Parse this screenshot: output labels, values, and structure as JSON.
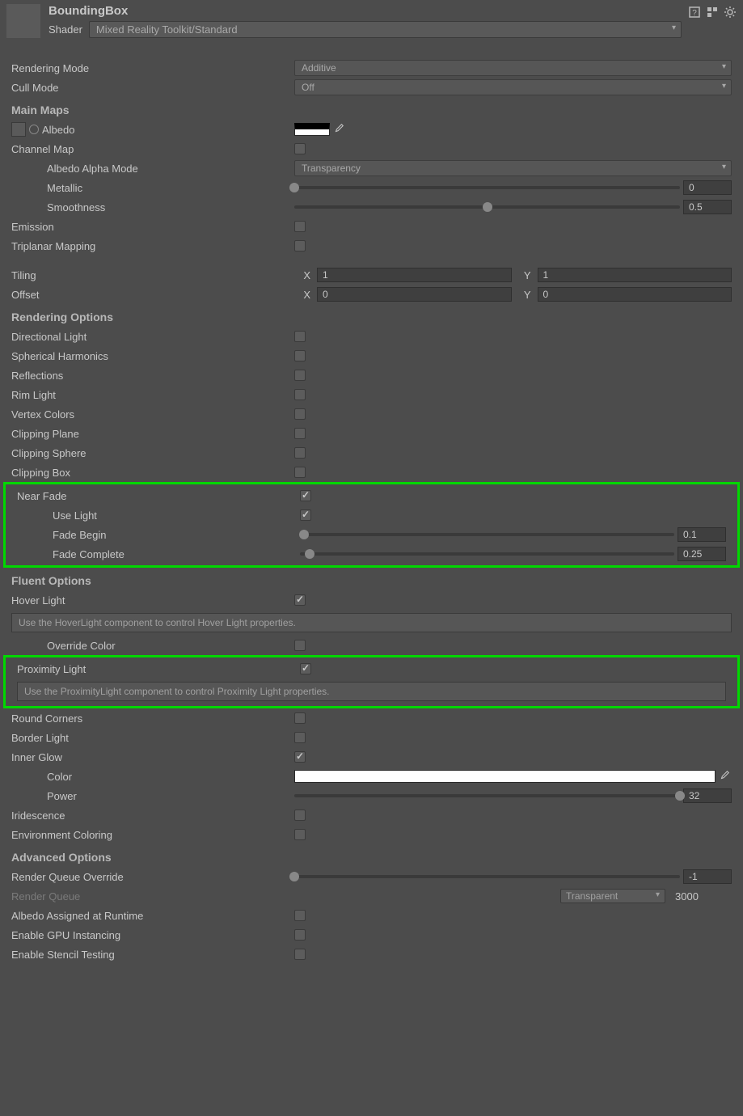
{
  "header": {
    "title": "BoundingBox",
    "shader_label": "Shader",
    "shader_value": "Mixed Reality Toolkit/Standard"
  },
  "rendering_mode": {
    "label": "Rendering Mode",
    "value": "Additive"
  },
  "cull_mode": {
    "label": "Cull Mode",
    "value": "Off"
  },
  "main_maps": {
    "heading": "Main Maps",
    "albedo_label": "Albedo",
    "channel_map_label": "Channel Map",
    "albedo_alpha_mode": {
      "label": "Albedo Alpha Mode",
      "value": "Transparency"
    },
    "metallic": {
      "label": "Metallic",
      "value": "0"
    },
    "smoothness": {
      "label": "Smoothness",
      "value": "0.5"
    },
    "emission_label": "Emission",
    "triplanar_label": "Triplanar Mapping",
    "tiling": {
      "label": "Tiling",
      "x": "1",
      "y": "1"
    },
    "offset": {
      "label": "Offset",
      "x": "0",
      "y": "0"
    },
    "x": "X",
    "y": "Y"
  },
  "rendering_options": {
    "heading": "Rendering Options",
    "directional_light": "Directional Light",
    "spherical_harmonics": "Spherical Harmonics",
    "reflections": "Reflections",
    "rim_light": "Rim Light",
    "vertex_colors": "Vertex Colors",
    "clipping_plane": "Clipping Plane",
    "clipping_sphere": "Clipping Sphere",
    "clipping_box": "Clipping Box",
    "near_fade": "Near Fade",
    "use_light": "Use Light",
    "fade_begin": {
      "label": "Fade Begin",
      "value": "0.1"
    },
    "fade_complete": {
      "label": "Fade Complete",
      "value": "0.25"
    }
  },
  "fluent_options": {
    "heading": "Fluent Options",
    "hover_light": "Hover Light",
    "hover_help": "Use the HoverLight component to control Hover Light properties.",
    "override_color": "Override Color",
    "proximity_light": "Proximity Light",
    "proximity_help": "Use the ProximityLight component to control Proximity Light properties.",
    "round_corners": "Round Corners",
    "border_light": "Border Light",
    "inner_glow": "Inner Glow",
    "color_label": "Color",
    "power": {
      "label": "Power",
      "value": "32"
    },
    "iridescence": "Iridescence",
    "environment_coloring": "Environment Coloring"
  },
  "advanced_options": {
    "heading": "Advanced Options",
    "render_queue_override": {
      "label": "Render Queue Override",
      "value": "-1"
    },
    "render_queue": {
      "label": "Render Queue",
      "dropdown": "Transparent",
      "value": "3000"
    },
    "albedo_runtime": "Albedo Assigned at Runtime",
    "gpu_instancing": "Enable GPU Instancing",
    "stencil_testing": "Enable Stencil Testing"
  }
}
